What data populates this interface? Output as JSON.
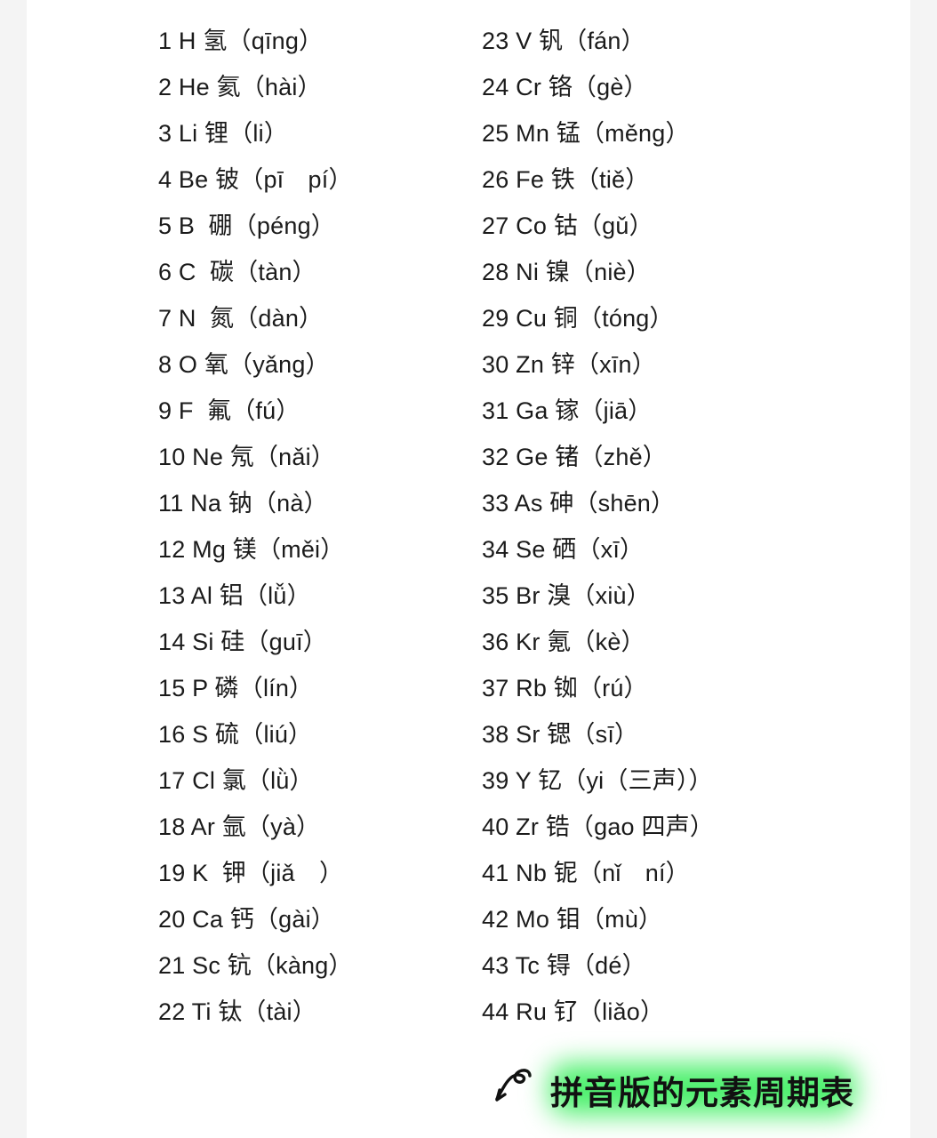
{
  "document": {
    "title": "拼音版的元素周期表",
    "background_color": "#f4f4f4",
    "card_color": "#ffffff",
    "text_color": "#1b1b1b"
  },
  "columns": {
    "left": [
      "1 H 氢（qīng）",
      "2 He 氦（hài）",
      "3 Li 锂（li）",
      "4 Be 铍（pī　pí）",
      "5 B  硼（péng）",
      "6 C  碳（tàn）",
      "7 N  氮（dàn）",
      "8 O 氧（yǎng）",
      "9 F  氟（fú）",
      "10 Ne 氖（nǎi）",
      "11 Na 钠（nà）",
      "12 Mg 镁（měi）",
      "13 Al 铝（lǚ）",
      "14 Si 硅（guī）",
      "15 P 磷（lín）",
      "16 S 硫（liú）",
      "17 Cl 氯（lǜ）",
      "18 Ar 氩（yà）",
      "19 K  钾（jiǎ　）",
      "20 Ca 钙（gài）",
      "21 Sc 钪（kàng）",
      "22 Ti 钛（tài）"
    ],
    "right": [
      "23 V 钒（fán）",
      "24 Cr 铬（gè）",
      "25 Mn 锰（měng）",
      "26 Fe 铁（tiě）",
      "27 Co 钴（gǔ）",
      "28 Ni 镍（niè）",
      "29 Cu 铜（tóng）",
      "30 Zn 锌（xīn）",
      "31 Ga 镓（jiā）",
      "32 Ge 锗（zhě）",
      "33 As 砷（shēn）",
      "34 Se 硒（xī）",
      "35 Br 溴（xiù）",
      "36 Kr 氪（kè）",
      "37 Rb 铷（rú）",
      "38 Sr 锶（sī）",
      "39 Y 钇（yi（三声））",
      "40 Zr 锆（gao 四声）",
      "41 Nb 铌（nǐ　ní）",
      "42 Mo 钼（mù）",
      "43 Tc 锝（dé）",
      "44 Ru 钌（liǎo）"
    ]
  },
  "caption": {
    "text": "拼音版的元素周期表",
    "arrow_icon": "curly-arrow-down-left-icon",
    "highlight_color": "#4ef06e",
    "text_color": "#111111"
  }
}
